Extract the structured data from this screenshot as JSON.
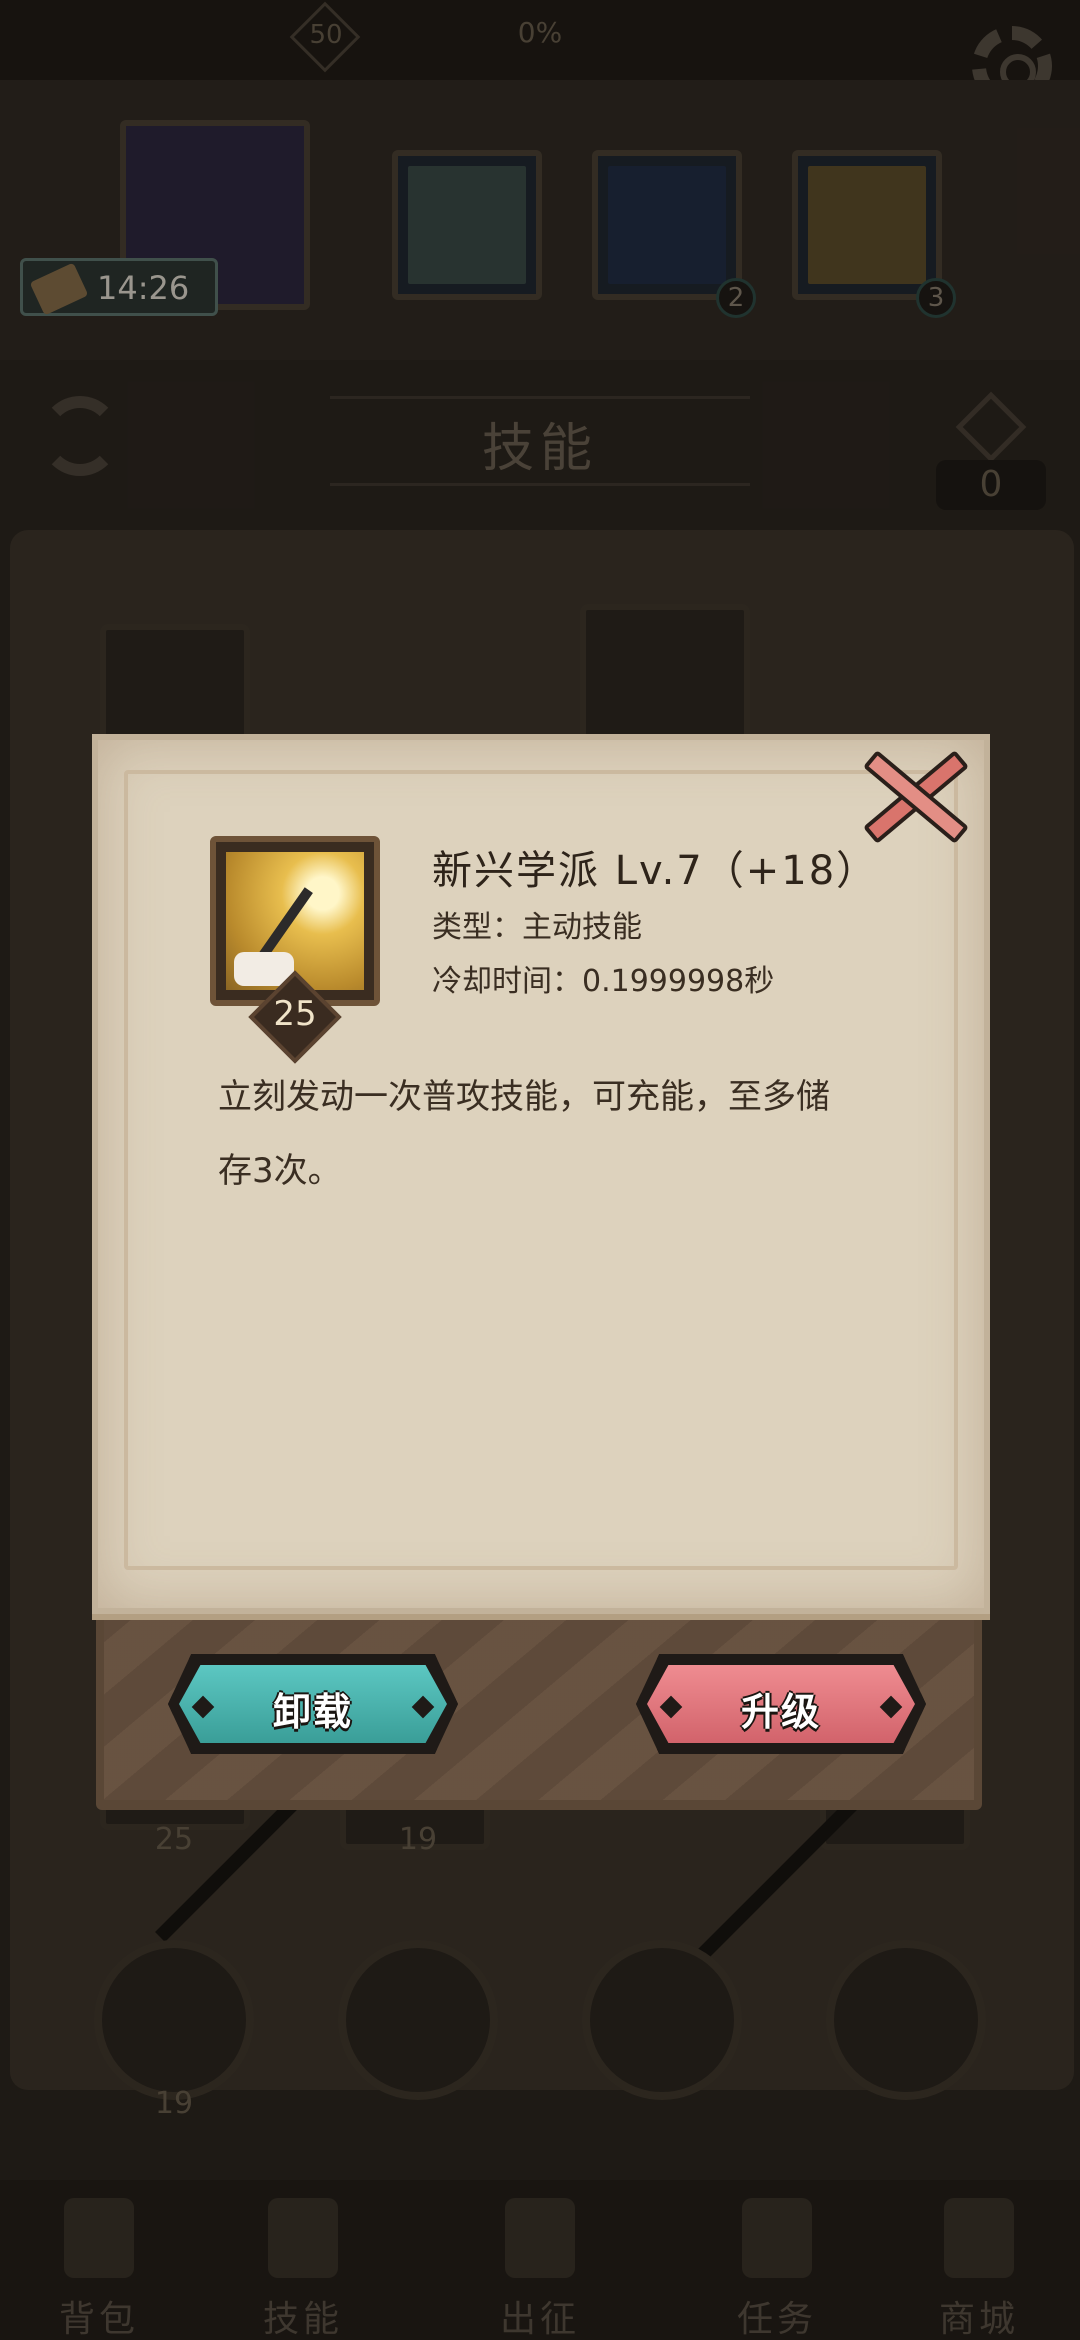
{
  "top_bar": {
    "level": "50",
    "progress": "0%"
  },
  "timer": "14:26",
  "hero_slots": [
    {
      "count": "2"
    },
    {
      "count": "3"
    }
  ],
  "section": {
    "title": "技能",
    "points": "0"
  },
  "tree": {
    "levels": [
      "25",
      "19",
      "19"
    ]
  },
  "bottom_nav": [
    {
      "label": "背包"
    },
    {
      "label": "技能"
    },
    {
      "label": "出征"
    },
    {
      "label": "任务"
    },
    {
      "label": "商城"
    }
  ],
  "popup": {
    "skill_level_badge": "25",
    "name": "新兴学派  Lv.7（+18）",
    "type_line": "类型：主动技能",
    "cooldown_line": "冷却时间：0.1999998秒",
    "description": "立刻发动一次普攻技能，可充能，至多储存3次。",
    "unload_label": "卸载",
    "upgrade_label": "升级"
  },
  "colors": {
    "unload": "#4bb5af",
    "upgrade": "#e0767d",
    "paper": "#ddd2bd"
  }
}
